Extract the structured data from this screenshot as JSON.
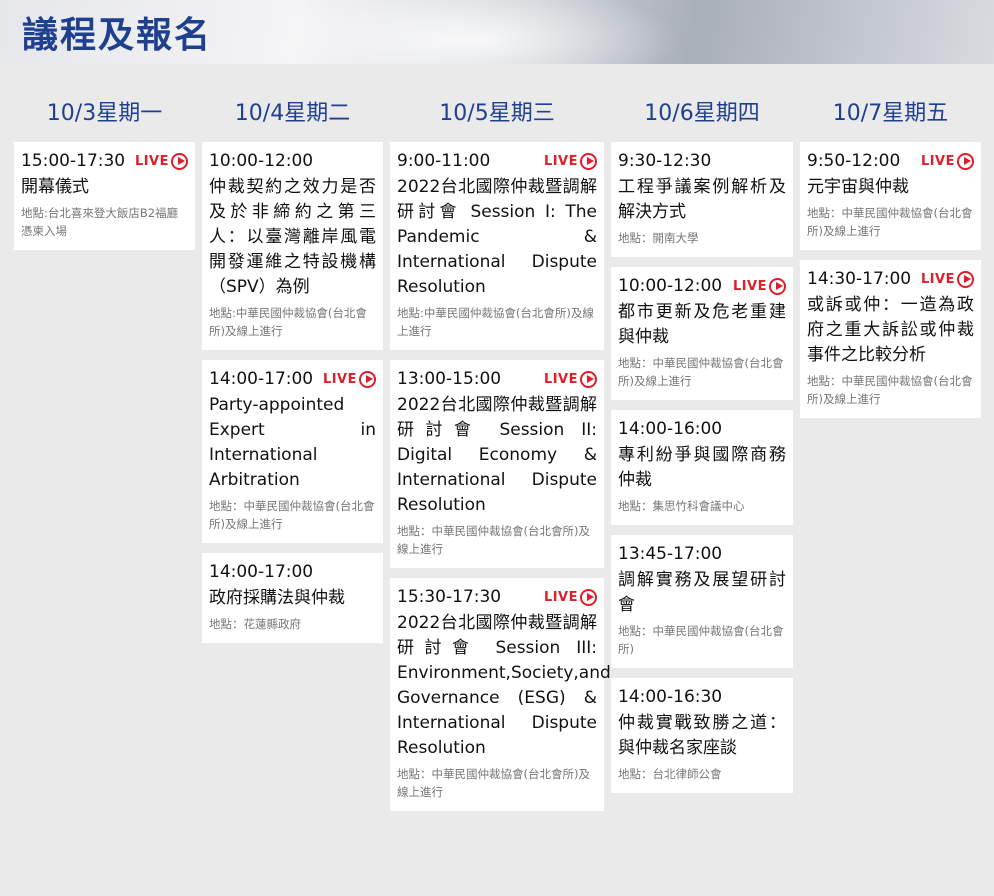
{
  "page": {
    "title": "議程及報名"
  },
  "live_label": "LIVE",
  "columns": [
    {
      "day": "10/3星期一",
      "sessions": [
        {
          "time": "15:00-17:30",
          "live": true,
          "title": "開幕儀式",
          "location": "地點:台北喜來登大飯店B2福廳憑柬入場"
        }
      ]
    },
    {
      "day": "10/4星期二",
      "sessions": [
        {
          "time": "10:00-12:00",
          "live": false,
          "title": "仲裁契約之效力是否及於非締約之第三人：以臺灣離岸風電開發運維之特設機構（SPV）為例",
          "location": "地點:中華民國仲裁協會(台北會所)及線上進行"
        },
        {
          "time": "14:00-17:00",
          "live": true,
          "title": "Party-appointed Expert in International Arbitration",
          "location": "地點：中華民國仲裁協會(台北會所)及線上進行"
        },
        {
          "time": "14:00-17:00",
          "live": false,
          "title": "政府採購法與仲裁",
          "location": "地點：花蓮縣政府"
        }
      ]
    },
    {
      "day": "10/5星期三",
      "sessions": [
        {
          "time": "9:00-11:00",
          "live": true,
          "title": "2022台北國際仲裁暨調解研討會 Session I: The Pandemic & International Dispute Resolution",
          "location": "地點:中華民國仲裁協會(台北會所)及線上進行"
        },
        {
          "time": "13:00-15:00",
          "live": true,
          "title": "2022台北國際仲裁暨調解研討會 Session II: Digital Economy & International Dispute Resolution",
          "location": "地點：中華民國仲裁協會(台北會所)及線上進行"
        },
        {
          "time": "15:30-17:30",
          "live": true,
          "title": "2022台北國際仲裁暨調解研討會 Session III: Environment,Society,and Governance (ESG) & International Dispute Resolution",
          "location": "地點：中華民國仲裁協會(台北會所)及線上進行"
        }
      ]
    },
    {
      "day": "10/6星期四",
      "sessions": [
        {
          "time": "9:30-12:30",
          "live": false,
          "title": "工程爭議案例解析及解決方式",
          "location": "地點：開南大學"
        },
        {
          "time": "10:00-12:00",
          "live": true,
          "title": "都市更新及危老重建與仲裁",
          "location": "地點：中華民國仲裁協會(台北會所)及線上進行"
        },
        {
          "time": "14:00-16:00",
          "live": false,
          "title": "專利紛爭與國際商務仲裁",
          "location": "地點：集思竹科會議中心"
        },
        {
          "time": "13:45-17:00",
          "live": false,
          "title": "調解實務及展望研討會",
          "location": "地點：中華民國仲裁協會(台北會所)"
        },
        {
          "time": "14:00-16:30",
          "live": false,
          "title": "仲裁實戰致勝之道：與仲裁名家座談",
          "location": "地點：台北律師公會"
        }
      ]
    },
    {
      "day": "10/7星期五",
      "sessions": [
        {
          "time": "9:50-12:00",
          "live": true,
          "title": "元宇宙與仲裁",
          "location": "地點：中華民國仲裁協會(台北會所)及線上進行"
        },
        {
          "time": "14:30-17:00",
          "live": true,
          "title": "或訴或仲：一造為政府之重大訴訟或仲裁事件之比較分析",
          "location": "地點：中華民國仲裁協會(台北會所)及線上進行"
        }
      ]
    }
  ]
}
